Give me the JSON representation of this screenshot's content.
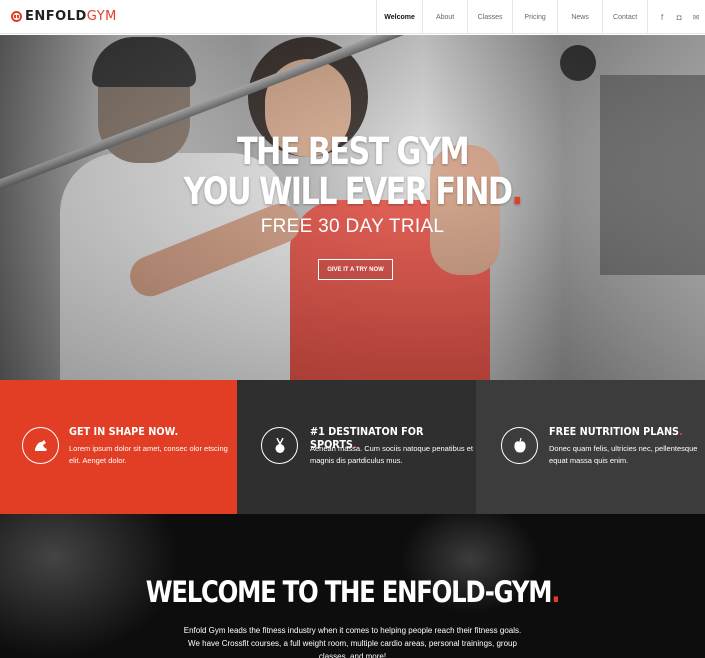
{
  "header": {
    "logo": {
      "main": "ENFOLD",
      "accent": "GYM"
    },
    "nav": [
      {
        "label": "Welcome",
        "active": true
      },
      {
        "label": "About",
        "active": false
      },
      {
        "label": "Classes",
        "active": false
      },
      {
        "label": "Pricing",
        "active": false
      },
      {
        "label": "News",
        "active": false
      },
      {
        "label": "Contact",
        "active": false
      }
    ],
    "socials": [
      {
        "icon": "facebook-icon",
        "glyph": "f"
      },
      {
        "icon": "instagram-icon",
        "glyph": "◘"
      },
      {
        "icon": "mail-icon",
        "glyph": "✉"
      }
    ]
  },
  "hero": {
    "title_line1": "THE BEST GYM",
    "title_line2": "YOU WILL EVER FIND",
    "title_dot": ".",
    "subtitle": "FREE 30 DAY TRIAL",
    "cta": "GIVE IT A TRY NOW"
  },
  "features": [
    {
      "icon": "flexed-arm-icon",
      "glyph": "💪",
      "title": "GET IN SHAPE NOW",
      "dot": ".",
      "text": "Lorem ipsum dolor sit amet, consec olor etscing elit. Aenget dolor."
    },
    {
      "icon": "medal-icon",
      "glyph": "🏅",
      "title": "#1 DESTINATON FOR SPORTS",
      "dot": ".",
      "text": "Aenean massa. Cum sociis natoque penatibus et magnis dis partdiculus mus."
    },
    {
      "icon": "apple-icon",
      "glyph": "🍎",
      "title": "FREE NUTRITION PLANS",
      "dot": ".",
      "text": "Donec quam felis, ultricies nec, pellentesque equat massa quis enim."
    }
  ],
  "welcome": {
    "title": "WELCOME TO THE ENFOLD-GYM",
    "dot": ".",
    "text": "Enfold Gym leads the fitness industry when it comes to helping people reach their fitness goals. We have Crossfit courses, a full weight room, multiple cardio areas, personal trainings, group classes, and more!"
  },
  "colors": {
    "accent": "#e23e26",
    "dark": "#2f2f2f",
    "darker": "#3c3c3c",
    "black": "#0d0d0d"
  }
}
